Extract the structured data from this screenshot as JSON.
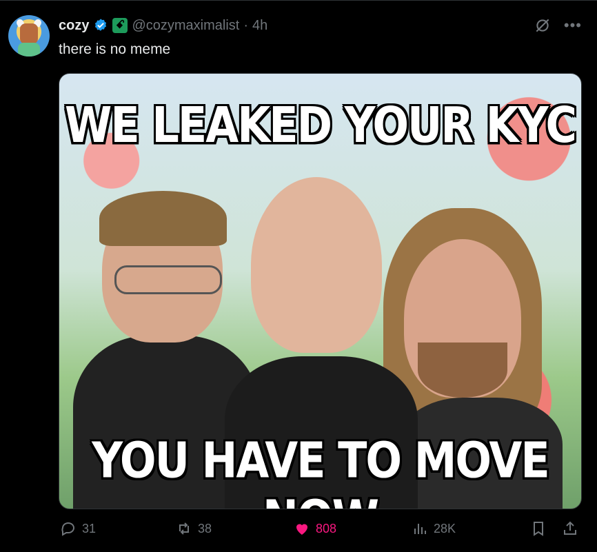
{
  "post": {
    "display_name": "cozy",
    "handle": "@cozymaximalist",
    "separator": "·",
    "time": "4h",
    "text": "there is no meme",
    "verified_icon": "verified-badge-icon",
    "affiliate_icon": "affiliate-badge-icon",
    "affiliate_glyph": "ꗃ"
  },
  "media": {
    "top_text": "WE LEAKED YOUR KYC",
    "bottom_text": "YOU HAVE TO MOVE NOW"
  },
  "actions": {
    "replies": "31",
    "reposts": "38",
    "likes": "808",
    "views": "28K"
  },
  "colors": {
    "accent": "#1d9bf0",
    "like": "#f91880",
    "muted": "#71767b",
    "text": "#e7e9ea",
    "background": "#000000"
  }
}
